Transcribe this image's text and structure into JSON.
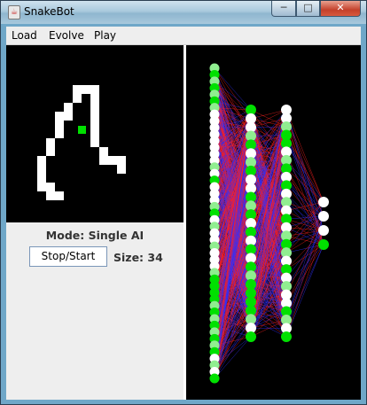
{
  "window": {
    "title": "SnakeBot"
  },
  "menu": [
    "Load",
    "Evolve",
    "Play"
  ],
  "status": {
    "mode": "Mode: Single AI",
    "button": "Stop/Start",
    "size": "Size: 34"
  },
  "colors": {
    "snake": "#ffffff",
    "food": "#00e000",
    "node_on": "#00e000",
    "node_mid": "#90ee90",
    "node_off": "#ffffff",
    "weight_pos": "#ff2020",
    "weight_neg": "#3030ff"
  },
  "network": {
    "layers": [
      [
        "mid",
        "on",
        "mid",
        "on",
        "mid",
        "on",
        "mid",
        "off",
        "off",
        "off",
        "off",
        "off",
        "off",
        "off",
        "off",
        "mid",
        "off",
        "on",
        "off",
        "off",
        "off",
        "mid",
        "on",
        "off",
        "mid",
        "off",
        "off",
        "mid",
        "off",
        "off",
        "off",
        "mid",
        "on",
        "on",
        "on",
        "on",
        "mid",
        "on",
        "mid",
        "on",
        "mid",
        "on",
        "mid",
        "on",
        "off",
        "mid",
        "off",
        "on"
      ],
      [
        "on",
        "off",
        "off",
        "mid",
        "on",
        "off",
        "mid",
        "on",
        "off",
        "off",
        "on",
        "mid",
        "on",
        "off",
        "on",
        "off",
        "on",
        "off",
        "on",
        "mid",
        "on",
        "on",
        "on",
        "on",
        "mid",
        "off",
        "on"
      ],
      [
        "off",
        "off",
        "mid",
        "on",
        "on",
        "off",
        "mid",
        "on",
        "off",
        "on",
        "off",
        "mid",
        "off",
        "on",
        "off",
        "mid",
        "on",
        "mid",
        "off",
        "on",
        "off",
        "mid",
        "off",
        "off",
        "on",
        "mid",
        "off",
        "on"
      ],
      [
        "off",
        "off",
        "off",
        "on"
      ]
    ]
  }
}
